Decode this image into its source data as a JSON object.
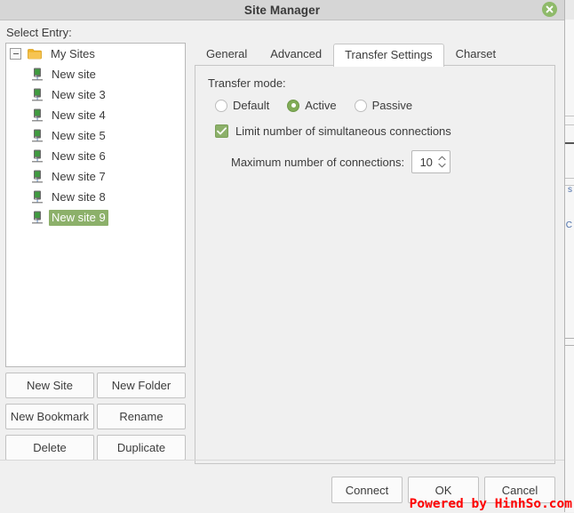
{
  "window": {
    "title": "Site Manager",
    "close_icon": "close-icon"
  },
  "sidebar": {
    "label": "Select Entry:",
    "tree": {
      "root": {
        "label": "My Sites",
        "icon": "folder-icon",
        "expander": "collapse-expander",
        "expanded": true
      },
      "items": [
        {
          "label": "New site",
          "icon": "server-icon",
          "selected": false
        },
        {
          "label": "New site 3",
          "icon": "server-icon",
          "selected": false
        },
        {
          "label": "New site 4",
          "icon": "server-icon",
          "selected": false
        },
        {
          "label": "New site 5",
          "icon": "server-icon",
          "selected": false
        },
        {
          "label": "New site 6",
          "icon": "server-icon",
          "selected": false
        },
        {
          "label": "New site 7",
          "icon": "server-icon",
          "selected": false
        },
        {
          "label": "New site 8",
          "icon": "server-icon",
          "selected": false
        },
        {
          "label": "New site 9",
          "icon": "server-icon",
          "selected": true
        }
      ]
    },
    "buttons": [
      {
        "label": "New Site"
      },
      {
        "label": "New Folder"
      },
      {
        "label": "New Bookmark"
      },
      {
        "label": "Rename"
      },
      {
        "label": "Delete"
      },
      {
        "label": "Duplicate"
      }
    ]
  },
  "tabs": [
    {
      "label": "General",
      "active": false
    },
    {
      "label": "Advanced",
      "active": false
    },
    {
      "label": "Transfer Settings",
      "active": true
    },
    {
      "label": "Charset",
      "active": false
    }
  ],
  "transfer_settings": {
    "group_label": "Transfer mode:",
    "modes": [
      {
        "label": "Default",
        "selected": false
      },
      {
        "label": "Active",
        "selected": true
      },
      {
        "label": "Passive",
        "selected": false
      }
    ],
    "limit_connections": {
      "label": "Limit number of simultaneous connections",
      "checked": true
    },
    "max_connections": {
      "label": "Maximum number of connections:",
      "value": "10"
    }
  },
  "footer": {
    "buttons": [
      {
        "label": "Connect"
      },
      {
        "label": "OK"
      },
      {
        "label": "Cancel"
      }
    ]
  },
  "watermark": {
    "text": "Powered by HinhSo.com",
    "color": "#fe0000"
  },
  "colors": {
    "accent_green": "#8cb06a",
    "selection_green": "#8cb06a",
    "titlebar": "#d6d6d6",
    "dialog_bg": "#f0f0f0",
    "folder_yellow": "#f0b429"
  }
}
